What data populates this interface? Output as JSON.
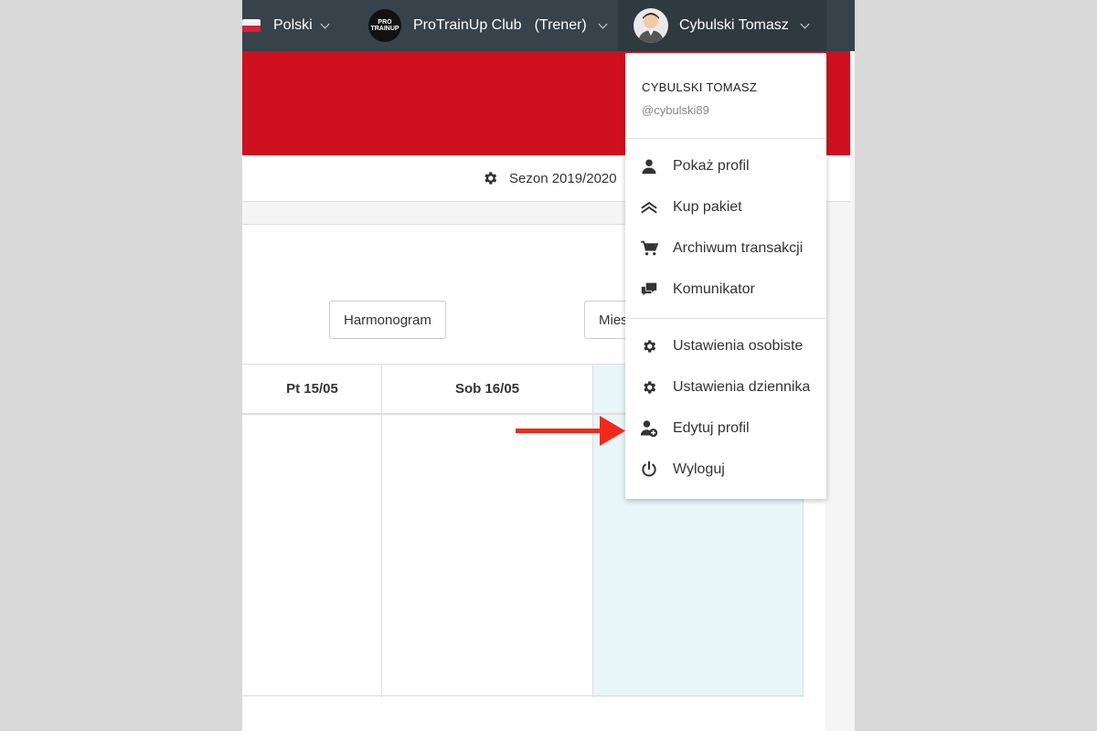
{
  "topbar": {
    "language": "Polski",
    "club_logo_text": "PRO TRAINUP",
    "club": "ProTrainUp Club",
    "role": "(Trener)",
    "user": "Cybulski Tomasz"
  },
  "season": {
    "label": "Sezon 2019/2020"
  },
  "toolbar": {
    "harmonogram": "Harmonogram",
    "month": "Mies"
  },
  "calendar": {
    "headers": [
      "Pt 15/05",
      "Sob 16/05"
    ]
  },
  "user_menu": {
    "name": "CYBULSKI TOMASZ",
    "handle": "@cybulski89",
    "items": [
      {
        "label": "Pokaż profil",
        "icon": "person-icon"
      },
      {
        "label": "Kup pakiet",
        "icon": "chevrons-up-icon"
      },
      {
        "label": "Archiwum transakcji",
        "icon": "cart-icon"
      },
      {
        "label": "Komunikator",
        "icon": "chat-icon"
      },
      {
        "label": "Ustawienia osobiste",
        "icon": "gear-icon"
      },
      {
        "label": "Ustawienia dziennika",
        "icon": "gear-icon"
      },
      {
        "label": "Edytuj profil",
        "icon": "user-edit-icon"
      },
      {
        "label": "Wyloguj",
        "icon": "power-icon"
      }
    ]
  },
  "colors": {
    "topbar": "#37424a",
    "brand_red": "#cf111f",
    "today_bg": "#e8f6f8",
    "arrow": "#f02a1a"
  }
}
